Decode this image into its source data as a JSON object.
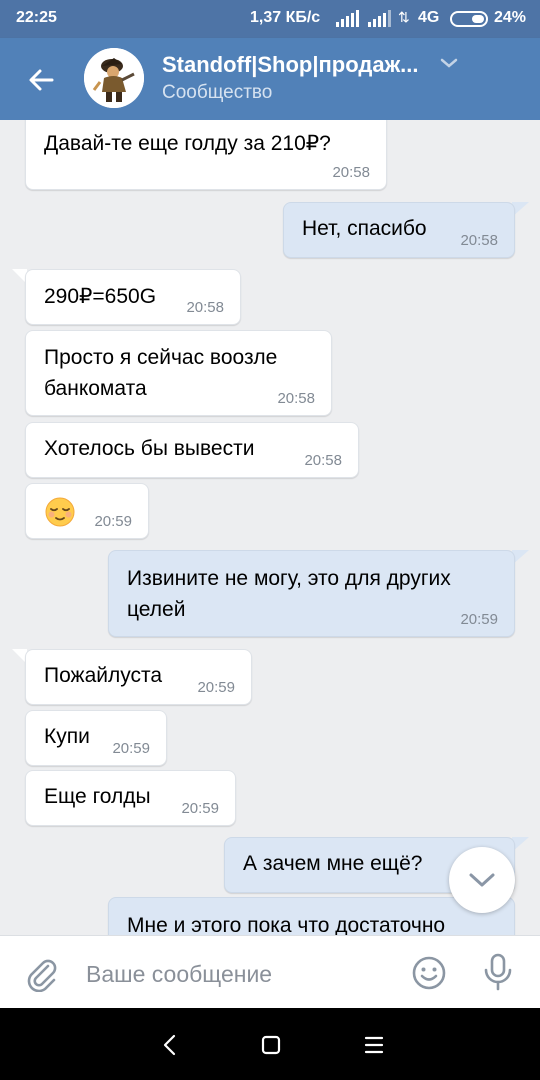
{
  "status_bar": {
    "time": "22:25",
    "network_speed": "1,37 КБ/с",
    "network_type": "4G",
    "battery": "24%"
  },
  "header": {
    "title": "Standoff|Shop|продаж...",
    "subtitle": "Сообщество",
    "icons": [
      "back-arrow-icon",
      "chevron-down-icon"
    ]
  },
  "messages": [
    {
      "direction": "in",
      "text": "Давай-те еще голду за 210₽?",
      "time": "20:58"
    },
    {
      "direction": "out",
      "text": "Нет, спасибо",
      "time": "20:58"
    },
    {
      "direction": "in",
      "text": "290₽=650G",
      "time": "20:58"
    },
    {
      "direction": "in",
      "lines": [
        "Просто я сейчас воозле",
        "банкомата"
      ],
      "time": "20:58"
    },
    {
      "direction": "in",
      "text": "Хотелось бы вывести",
      "time": "20:58"
    },
    {
      "direction": "in",
      "emoji": "relieved-face",
      "time": "20:59"
    },
    {
      "direction": "out",
      "lines": [
        "Извините не могу, это для других",
        "целей"
      ],
      "time": "20:59"
    },
    {
      "direction": "in",
      "text": "Пожайлуста",
      "time": "20:59"
    },
    {
      "direction": "in",
      "text": "Купи",
      "time": "20:59"
    },
    {
      "direction": "in",
      "text": "Еще голды",
      "time": "20:59"
    },
    {
      "direction": "out",
      "text": "А зачем мне ещё?",
      "time": ""
    },
    {
      "direction": "out",
      "text": "Мне и этого пока что достаточно",
      "time": ""
    }
  ],
  "composer": {
    "placeholder": "Ваше сообщение",
    "icons": [
      "paperclip-icon",
      "emoji-icon",
      "microphone-icon"
    ]
  },
  "colors": {
    "status_bar": "#4e74a6",
    "header": "#5181b8",
    "chat_bg": "#edeef0",
    "bubble_in": "#ffffff",
    "bubble_out": "#dbe6f4",
    "timestamp": "#828a94"
  },
  "nav_bar": {
    "icons": [
      "nav-back-icon",
      "nav-home-icon",
      "nav-recents-icon"
    ]
  }
}
